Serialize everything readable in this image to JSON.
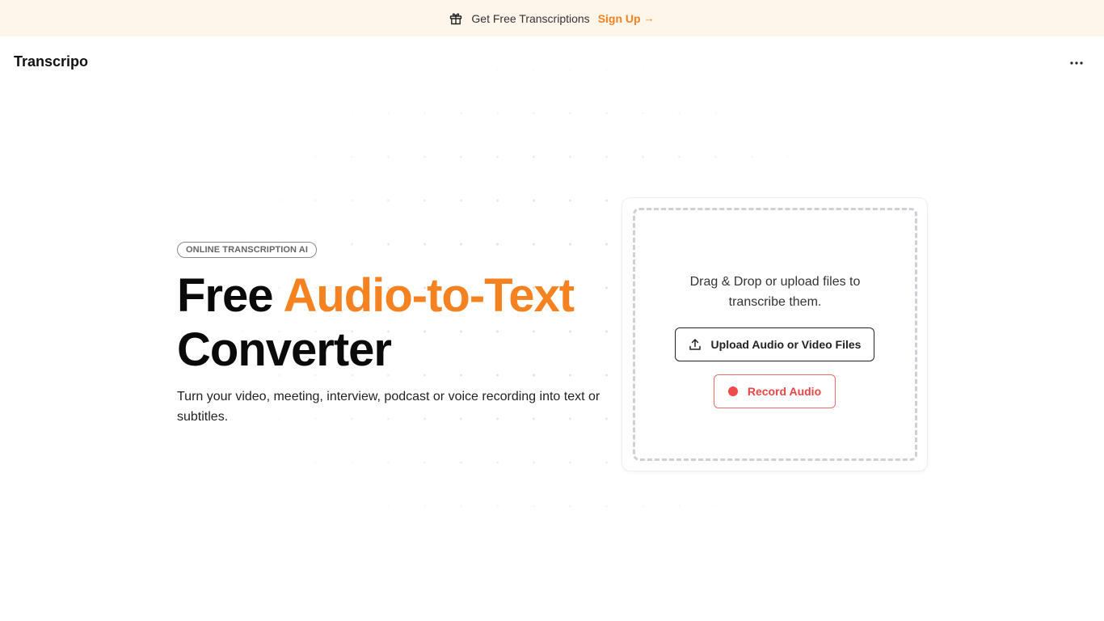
{
  "banner": {
    "text": "Get Free Transcriptions",
    "link_label": "Sign Up",
    "link_arrow": "→",
    "icon": "gift-icon",
    "background": "#fef6ea",
    "link_color": "#f58220"
  },
  "header": {
    "logo": "Transcripo",
    "menu_icon": "more-horizontal-icon"
  },
  "hero": {
    "badge": "ONLINE TRANSCRIPTION AI",
    "title_plain": "Free ",
    "title_accent": "Audio-to-Text",
    "title_line2": "Converter",
    "subtitle": "Turn your video, meeting, interview, podcast or voice recording into text or subtitles.",
    "accent_color": "#f58220"
  },
  "upload_card": {
    "drop_text": "Drag & Drop or upload files to transcribe them.",
    "upload_label": "Upload Audio or Video Files",
    "upload_icon": "upload-icon",
    "record_label": "Record Audio",
    "record_icon": "record-dot-icon",
    "record_color": "#ef4b4b"
  }
}
